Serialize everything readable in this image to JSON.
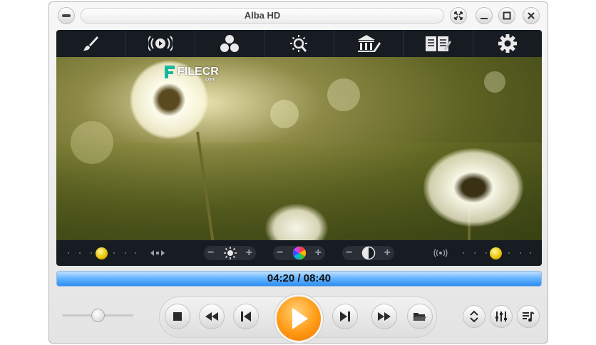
{
  "window": {
    "title": "Alba HD"
  },
  "toolbar": {
    "items": [
      {
        "icon": "brush-icon"
      },
      {
        "icon": "audio-broadcast-icon"
      },
      {
        "icon": "color-balls-icon"
      },
      {
        "icon": "brightness-zoom-icon"
      },
      {
        "icon": "library-edit-icon"
      },
      {
        "icon": "book-list-icon"
      },
      {
        "icon": "gear-icon"
      }
    ]
  },
  "video": {
    "watermark": "FILECR",
    "watermark_sub": ".com"
  },
  "video_controls": {
    "balance_level": 0.5,
    "brightness": {
      "minus": "−",
      "plus": "+"
    },
    "color": {
      "minus": "−",
      "plus": "+"
    },
    "contrast": {
      "minus": "−",
      "plus": "+"
    },
    "audio_level": 0.5
  },
  "progress": {
    "elapsed": "04:20",
    "separator": " / ",
    "total": "08:40",
    "fraction": 0.5
  },
  "volume": {
    "level": 0.45
  },
  "colors": {
    "accent": "#2e8ef0",
    "play": "#ff9a14",
    "dark_panel": "#171b22"
  }
}
